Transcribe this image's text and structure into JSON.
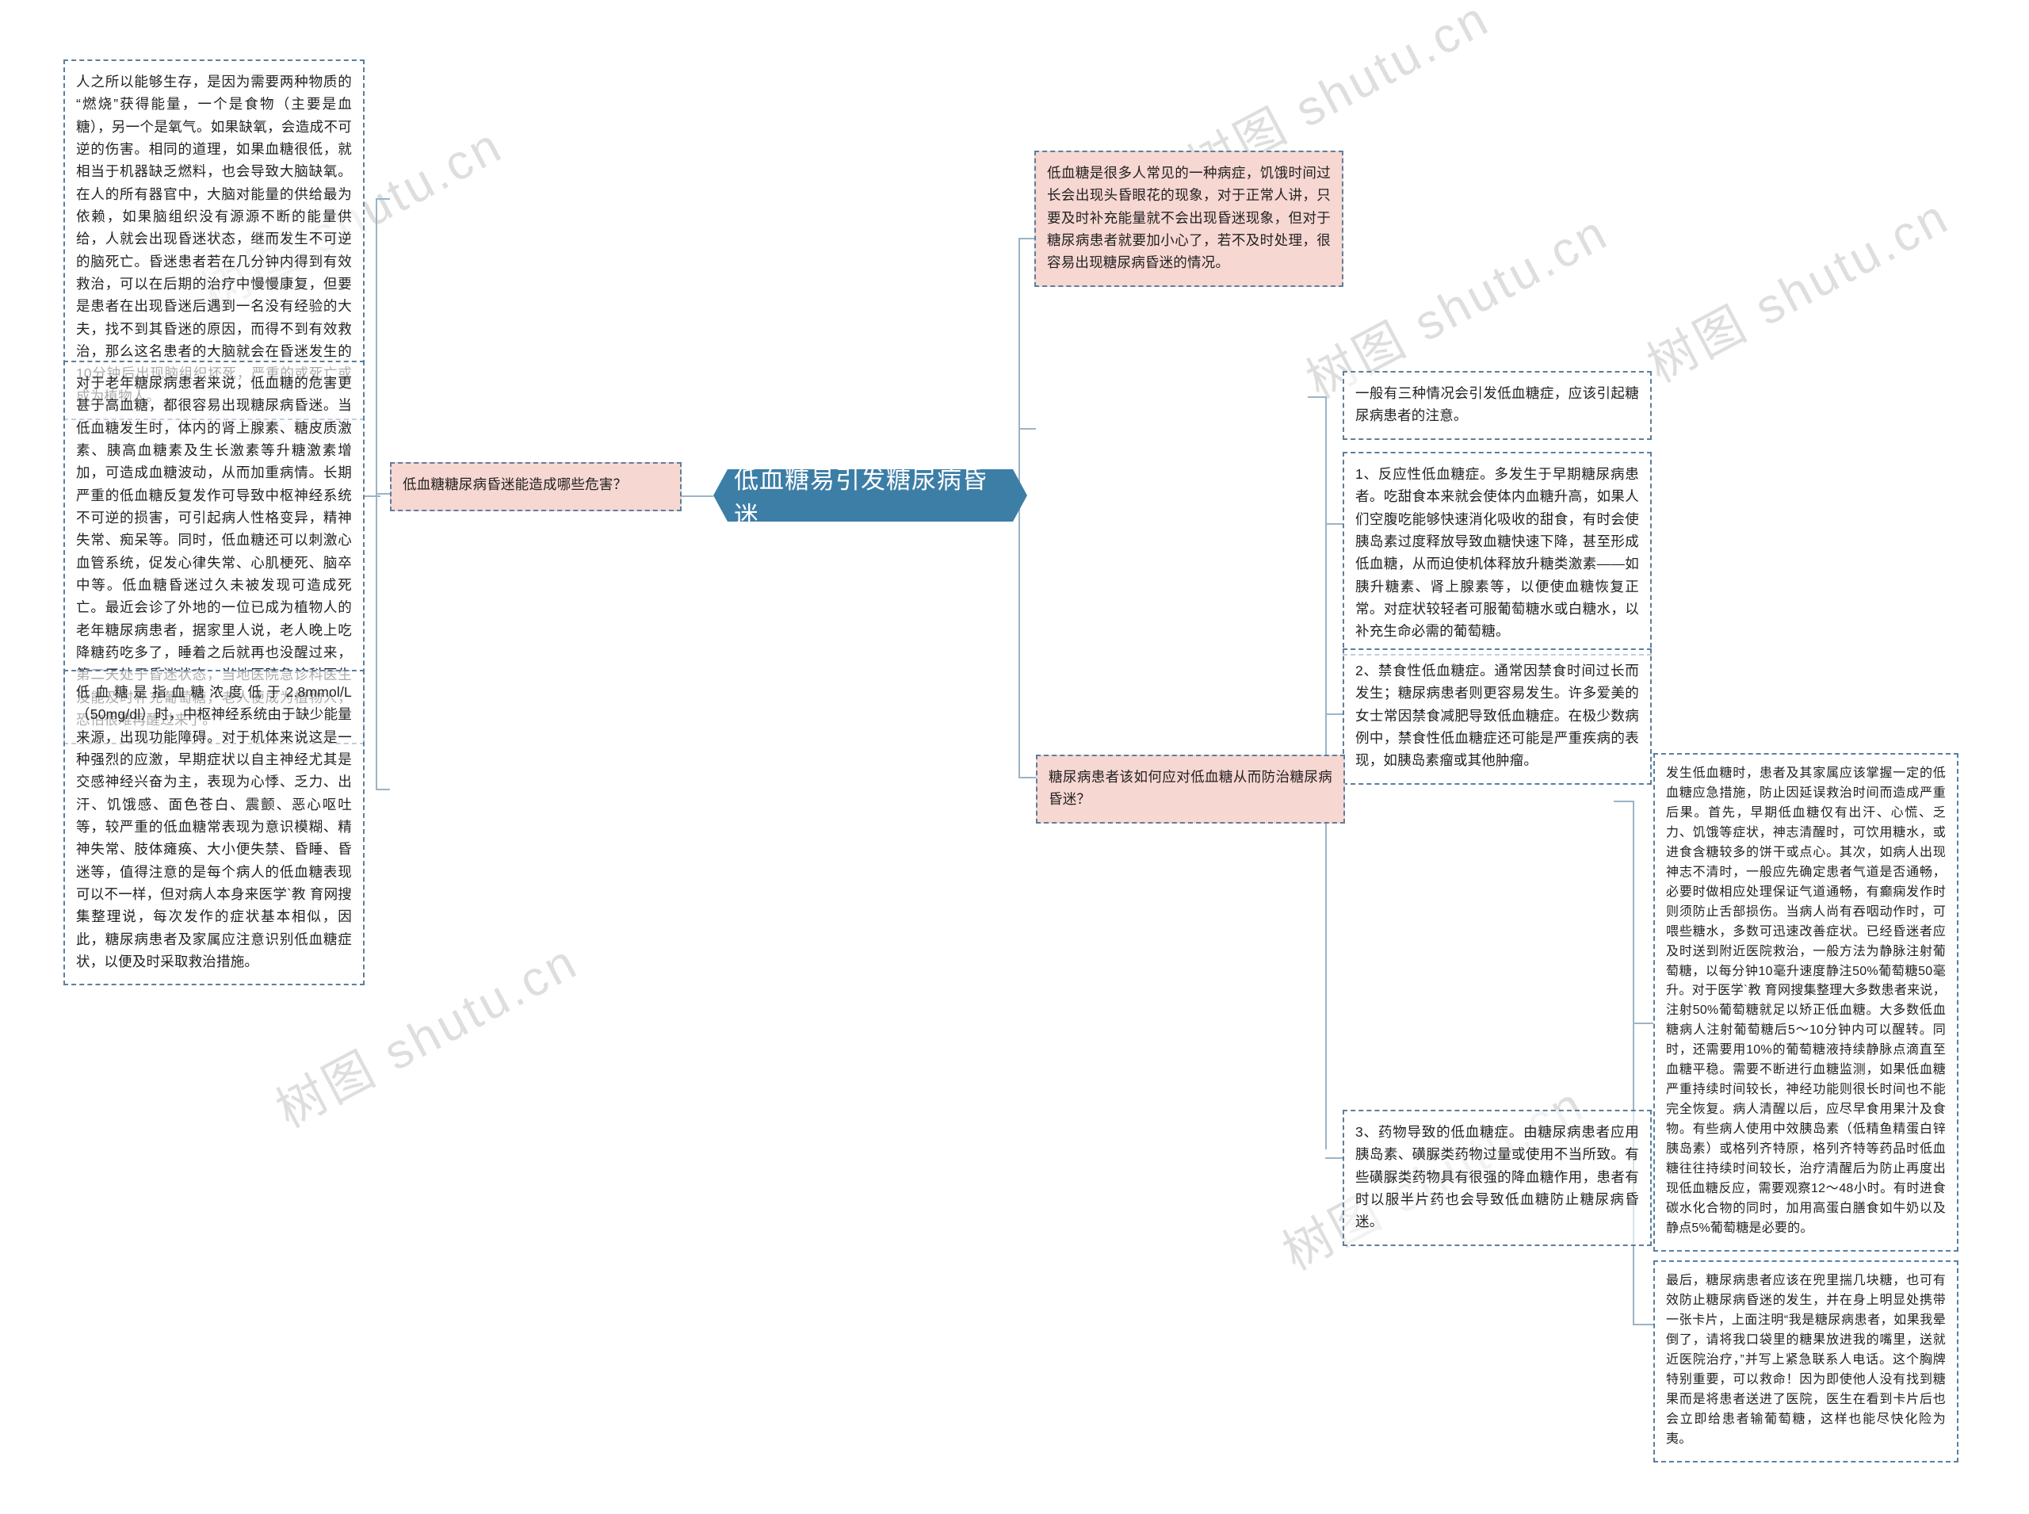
{
  "diagram": {
    "type": "mindmap",
    "title": "低血糖易引发糖尿病昏迷",
    "watermark_text": "树图 shutu.cn",
    "colors": {
      "central_fill": "#3d7ea6",
      "central_text": "#ffffff",
      "node_border": "#5b7f9c",
      "pink_fill": "#f7d7d2",
      "white_fill": "#ffffff",
      "body_text": "#222222",
      "connector": "#9bb4c6",
      "watermark": "#d9d9d9"
    }
  },
  "central": {
    "label": "低血糖易引发糖尿病昏迷"
  },
  "branches": {
    "left": {
      "topic": {
        "label": "低血糖糖尿病昏迷能造成哪些危害？"
      },
      "details": [
        {
          "id": "left-detail-1",
          "text": "人之所以能够生存，是因为需要两种物质的“燃烧”获得能量，一个是食物（主要是血糖），另一个是氧气。如果缺氧，会造成不可逆的伤害。相同的道理，如果血糖很低，就相当于机器缺乏燃料，也会导致大脑缺氧。在人的所有器官中，大脑对能量的供给最为依赖，如果脑组织没有源源不断的能量供给，人就会出现昏迷状态，继而发生不可逆的脑死亡。昏迷患者若在几分钟内得到有效救治，可以在后期的治疗中慢慢康复，但要是患者在出现昏迷后遇到一名没有经验的大夫，找不到其昏迷的原因，而得不到有效救治，那么这名患者的大脑就会在昏迷发生的10分钟后出现脑组织坏死，严重的或死亡或成为植物人。"
        },
        {
          "id": "left-detail-2",
          "text": "对于老年糖尿病患者来说，低血糖的危害更甚于高血糖，都很容易出现糖尿病昏迷。当低血糖发生时，体内的肾上腺素、糖皮质激素、胰高血糖素及生长激素等升糖激素增加，可造成血糖波动，从而加重病情。长期严重的低血糖反复发作可导致中枢神经系统不可逆的损害，可引起病人性格变异，精神失常、痴呆等。同时，低血糖还可以刺激心血管系统，促发心律失常、心肌梗死、脑卒中等。低血糖昏迷过久未被发现可造成死亡。最近会诊了外地的一位已成为植物人的老年糖尿病患者，据家里人说，老人晚上吃降糖药吃多了，睡着之后就再也没醒过来，第二天处于昏迷状态，当地医院急诊科医生没能及时补充葡萄糖，老人便成为植物人，恐怕很难再醒过来了。"
        },
        {
          "id": "left-detail-3",
          "text": "低血糖是指血糖浓度低于2.8mmol/L（50mg/dl）时，中枢神经系统由于缺少能量来源，出现功能障碍。对于机体来说这是一种强烈的应激，早期症状以自主神经尤其是交感神经兴奋为主，表现为心悸、乏力、出汗、饥饿感、面色苍白、震颤、恶心呕吐等，较严重的低血糖常表现为意识模糊、精神失常、肢体瘫痪、大小便失禁、昏睡、昏迷等，值得注意的是每个病人的低血糖表现可以不一样，但对病人本身来医学`教 育网搜集整理说，每次发作的症状基本相似，因此，糖尿病患者及家属应注意识别低血糖症状，以便及时采取救治措施。"
        }
      ]
    },
    "right_top": {
      "intro": {
        "text": "低血糖是很多人常见的一种病症，饥饿时间过长会出现头昏眼花的现象，对于正常人讲，只要及时补充能量就不会出现昏迷现象，但对于糖尿病患者就要加小心了，若不及时处理，很容易出现糖尿病昏迷的情况。"
      }
    },
    "right_middle": {
      "summary": {
        "text": "一般有三种情况会引发低血糖症，应该引起糖尿病患者的注意。"
      },
      "causes": [
        {
          "id": "cause-1",
          "text": "1、反应性低血糖症。多发生于早期糖尿病患者。吃甜食本来就会使体内血糖升高，如果人们空腹吃能够快速消化吸收的甜食，有时会使胰岛素过度释放导致血糖快速下降，甚至形成低血糖，从而迫使机体释放升糖类激素——如胰升糖素、肾上腺素等，以便使血糖恢复正常。对症状较轻者可服葡萄糖水或白糖水，以补充生命必需的葡萄糖。"
        },
        {
          "id": "cause-2",
          "text": "2、禁食性低血糖症。通常因禁食时间过长而发生；糖尿病患者则更容易发生。许多爱美的女士常因禁食减肥导致低血糖症。在极少数病例中，禁食性低血糖症还可能是严重疾病的表现，如胰岛素瘤或其他肿瘤。"
        },
        {
          "id": "cause-3",
          "text": "3、药物导致的低血糖症。由糖尿病患者应用胰岛素、磺脲类药物过量或使用不当所致。有些磺脲类药物具有很强的降血糖作用，患者有时以服半片药也会导致低血糖防止糖尿病昏迷。"
        }
      ]
    },
    "right_bottom": {
      "topic": {
        "label": "糖尿病患者该如何应对低血糖从而防治糖尿病昏迷？"
      },
      "details": [
        {
          "id": "right-detail-1",
          "text": "发生低血糖时，患者及其家属应该掌握一定的低血糖应急措施，防止因延误救治时间而造成严重后果。首先，早期低血糖仅有出汗、心慌、乏力、饥饿等症状，神志清醒时，可饮用糖水，或进食含糖较多的饼干或点心。其次，如病人出现神志不清时，一般应先确定患者气道是否通畅，必要时做相应处理保证气道通畅，有癫痫发作时则须防止舌部损伤。当病人尚有吞咽动作时，可喂些糖水，多数可迅速改善症状。已经昏迷者应及时送到附近医院救治，一般方法为静脉注射葡萄糖，以每分钟10毫升速度静注50%葡萄糖50毫升。对于医学`教 育网搜集整理大多数患者来说，注射50%葡萄糖就足以矫正低血糖。大多数低血糖病人注射葡萄糖后5～10分钟内可以醒转。同时，还需要用10%的葡萄糖液持续静脉点滴直至血糖平稳。需要不断进行血糖监测，如果低血糖严重持续时间较长，神经功能则很长时间也不能完全恢复。病人清醒以后，应尽早食用果汁及食物。有些病人使用中效胰岛素（低精鱼精蛋白锌胰岛素）或格列齐特原，格列齐特等药品时低血糖往往持续时间较长，治疗清醒后为防止再度出现低血糖反应，需要观察12～48小时。有时进食碳水化合物的同时，加用高蛋白膳食如牛奶以及静点5%葡萄糖是必要的。"
        },
        {
          "id": "right-detail-2",
          "text": "最后，糖尿病患者应该在兜里揣几块糖，也可有效防止糖尿病昏迷的发生，并在身上明显处携带一张卡片，上面注明“我是糖尿病患者，如果我晕倒了，请将我口袋里的糖果放进我的嘴里，送就近医院治疗，”并写上紧急联系人电话。这个胸牌特别重要，可以救命！因为即使他人没有找到糖果而是将患者送进了医院，医生在看到卡片后也会立即给患者输葡萄糖，这样也能尽快化险为夷。"
        }
      ]
    }
  }
}
